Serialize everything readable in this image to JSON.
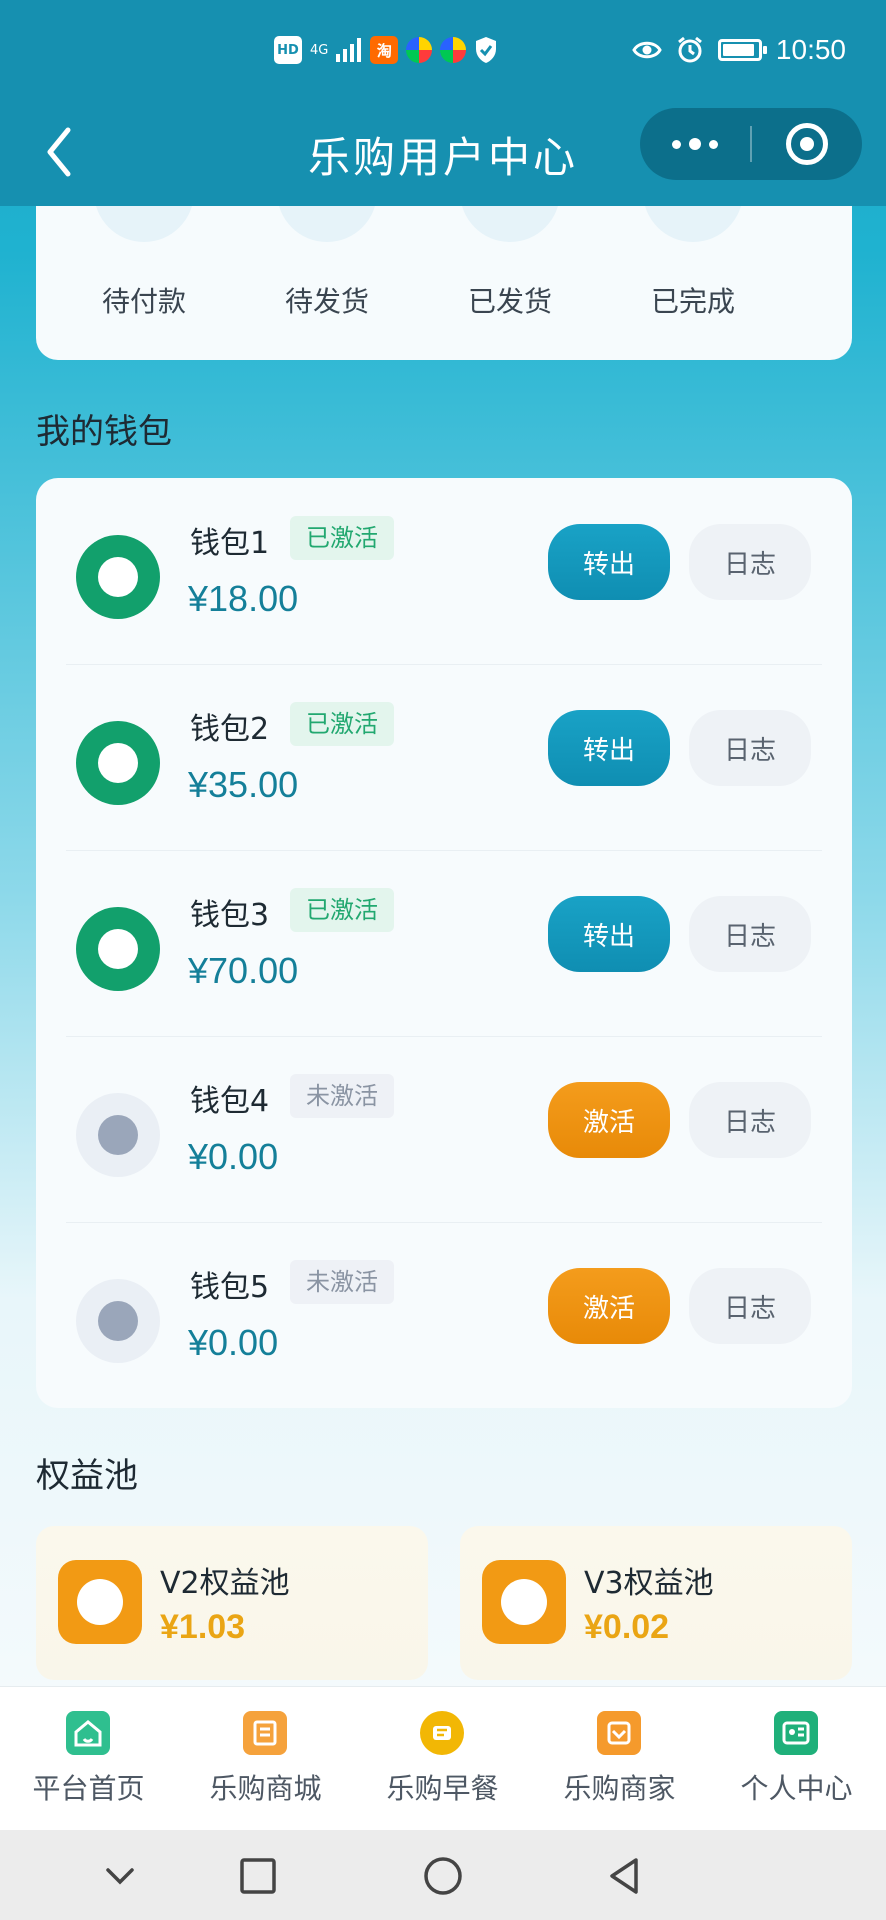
{
  "status_bar": {
    "hd": "HD",
    "network": "4G",
    "taobao": "淘",
    "time": "10:50",
    "battery_level": 0.9
  },
  "header": {
    "title": "乐购用户中心"
  },
  "orders": {
    "items": [
      {
        "label": "待付款",
        "icon": "wallet-icon"
      },
      {
        "label": "待发货",
        "icon": "document-icon"
      },
      {
        "label": "已发货",
        "icon": "delivery-icon"
      },
      {
        "label": "已完成",
        "icon": "checkmark-icon"
      }
    ]
  },
  "wallet_section": {
    "title": "我的钱包",
    "transfer_label": "转出",
    "activate_label": "激活",
    "log_label": "日志",
    "wallets": [
      {
        "name": "钱包1",
        "status": "已激活",
        "active": true,
        "amount": "¥18.00"
      },
      {
        "name": "钱包2",
        "status": "已激活",
        "active": true,
        "amount": "¥35.00"
      },
      {
        "name": "钱包3",
        "status": "已激活",
        "active": true,
        "amount": "¥70.00"
      },
      {
        "name": "钱包4",
        "status": "未激活",
        "active": false,
        "amount": "¥0.00"
      },
      {
        "name": "钱包5",
        "status": "未激活",
        "active": false,
        "amount": "¥0.00"
      }
    ]
  },
  "pool_section": {
    "title": "权益池",
    "pools": [
      {
        "name": "V2权益池",
        "amount": "¥1.03"
      },
      {
        "name": "V3权益池",
        "amount": "¥0.02"
      }
    ]
  },
  "tabbar": {
    "tabs": [
      {
        "label": "平台首页",
        "icon": "home-icon",
        "color": "#2fbf8f"
      },
      {
        "label": "乐购商城",
        "icon": "mall-icon",
        "color": "#f5a23c"
      },
      {
        "label": "乐购早餐",
        "icon": "breakfast-icon",
        "color": "#f2b705"
      },
      {
        "label": "乐购商家",
        "icon": "merchant-icon",
        "color": "#f59a2c"
      },
      {
        "label": "个人中心",
        "icon": "profile-icon",
        "color": "#1fb07a"
      }
    ]
  },
  "colors": {
    "header_bg": "#1690b0",
    "active_green": "#12a06c",
    "transfer_blue": "#0f8eb2",
    "activate_orange": "#e88a08",
    "amount_teal": "#147f99",
    "pool_amount_gold": "#eaa514"
  }
}
